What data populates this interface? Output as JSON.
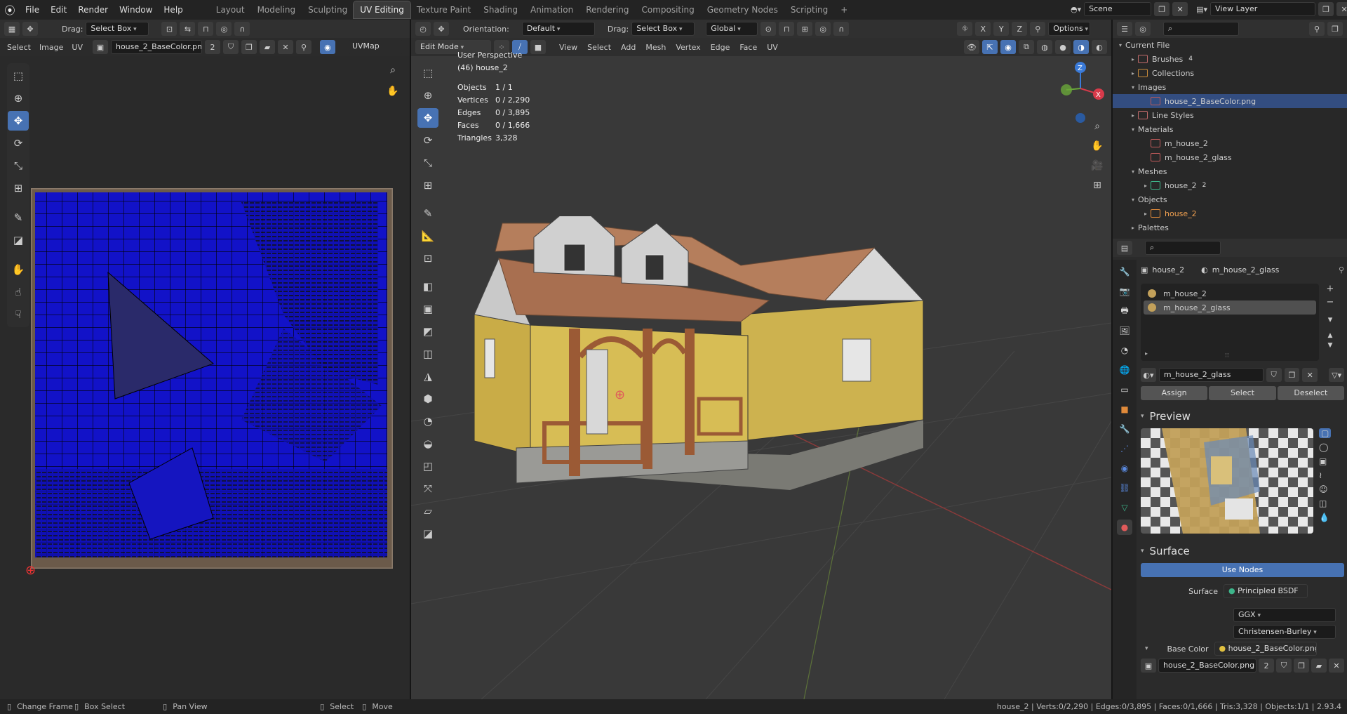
{
  "app": {
    "menu": [
      "File",
      "Edit",
      "Render",
      "Window",
      "Help"
    ],
    "workspaces": [
      "Layout",
      "Modeling",
      "Sculpting",
      "UV Editing",
      "Texture Paint",
      "Shading",
      "Animation",
      "Rendering",
      "Compositing",
      "Geometry Nodes",
      "Scripting"
    ],
    "active_workspace": "UV Editing",
    "add_tab": "+",
    "scene": "Scene",
    "view_layer": "View Layer"
  },
  "uv_editor": {
    "drag_label": "Drag:",
    "drag_mode": "Select Box",
    "menus": [
      "Select",
      "Image",
      "UV"
    ],
    "image_name": "house_2_BaseColor.png",
    "image_users": "2",
    "uvmap": "UVMap"
  },
  "viewport": {
    "orientation_label": "Orientation:",
    "orientation": "Default",
    "drag_label": "Drag:",
    "drag_mode": "Select Box",
    "transform_orientation": "Global",
    "options": "Options",
    "mode": "Edit Mode",
    "menus": [
      "View",
      "Select",
      "Add",
      "Mesh",
      "Vertex",
      "Edge",
      "Face",
      "UV"
    ],
    "axis_x": "X",
    "axis_y": "Y",
    "axis_z": "Z",
    "perspective": "User Perspective",
    "object_label": "(46) house_2",
    "stats": [
      {
        "label": "Objects",
        "value": "1 / 1"
      },
      {
        "label": "Vertices",
        "value": "0 / 2,290"
      },
      {
        "label": "Edges",
        "value": "0 / 3,895"
      },
      {
        "label": "Faces",
        "value": "0 / 1,666"
      },
      {
        "label": "Triangles",
        "value": "3,328"
      }
    ]
  },
  "outliner": {
    "root": "Current File",
    "items": [
      {
        "label": "Brushes",
        "badge": "4",
        "depth": 1,
        "expand": "▸",
        "color": "#c06a6a"
      },
      {
        "label": "Collections",
        "badge": "",
        "depth": 1,
        "expand": "▸",
        "color": "#c88a3a"
      },
      {
        "label": "Images",
        "badge": "",
        "depth": 1,
        "expand": "▾",
        "color": ""
      },
      {
        "label": "house_2_BaseColor.png",
        "badge": "",
        "depth": 2,
        "expand": "",
        "color": "#b85a5a",
        "selected": true
      },
      {
        "label": "Line Styles",
        "badge": "",
        "depth": 1,
        "expand": "▸",
        "color": "#c06a6a"
      },
      {
        "label": "Materials",
        "badge": "",
        "depth": 1,
        "expand": "▾",
        "color": ""
      },
      {
        "label": "m_house_2",
        "badge": "",
        "depth": 2,
        "expand": "",
        "color": "#c05a5a"
      },
      {
        "label": "m_house_2_glass",
        "badge": "",
        "depth": 2,
        "expand": "",
        "color": "#c05a5a"
      },
      {
        "label": "Meshes",
        "badge": "",
        "depth": 1,
        "expand": "▾",
        "color": ""
      },
      {
        "label": "house_2",
        "badge": "2",
        "depth": 2,
        "expand": "▸",
        "color": "#3db58a"
      },
      {
        "label": "Objects",
        "badge": "",
        "depth": 1,
        "expand": "▾",
        "color": ""
      },
      {
        "label": "house_2",
        "badge": "",
        "depth": 2,
        "expand": "▸",
        "color": "#e08a3a",
        "orange": true
      },
      {
        "label": "Palettes",
        "badge": "",
        "depth": 1,
        "expand": "▸",
        "color": ""
      }
    ]
  },
  "properties": {
    "breadcrumb_object": "house_2",
    "breadcrumb_material": "m_house_2_glass",
    "slots": [
      "m_house_2",
      "m_house_2_glass"
    ],
    "active_slot": 1,
    "material_name": "m_house_2_glass",
    "assign": "Assign",
    "select": "Select",
    "deselect": "Deselect",
    "preview_title": "Preview",
    "surface_title": "Surface",
    "use_nodes": "Use Nodes",
    "surface_label": "Surface",
    "surface_value": "Principled BSDF",
    "distribution": "GGX",
    "subsurface_method": "Christensen-Burley",
    "base_color_label": "Base Color",
    "base_color_value": "house_2_BaseColor.png",
    "image_name": "house_2_BaseColor.png",
    "image_users": "2"
  },
  "statusbar": {
    "items": [
      "Change Frame",
      "Box Select",
      "Pan View",
      "Select",
      "Move"
    ],
    "stats": "house_2 | Verts:0/2,290 | Edges:0/3,895 | Faces:0/1,666 | Tris:3,328 | Objects:1/1 | 2.93.4"
  },
  "colors": {
    "accent": "#4772b3",
    "uv_fill": "#1010c8",
    "selected_row": "#334d80"
  }
}
